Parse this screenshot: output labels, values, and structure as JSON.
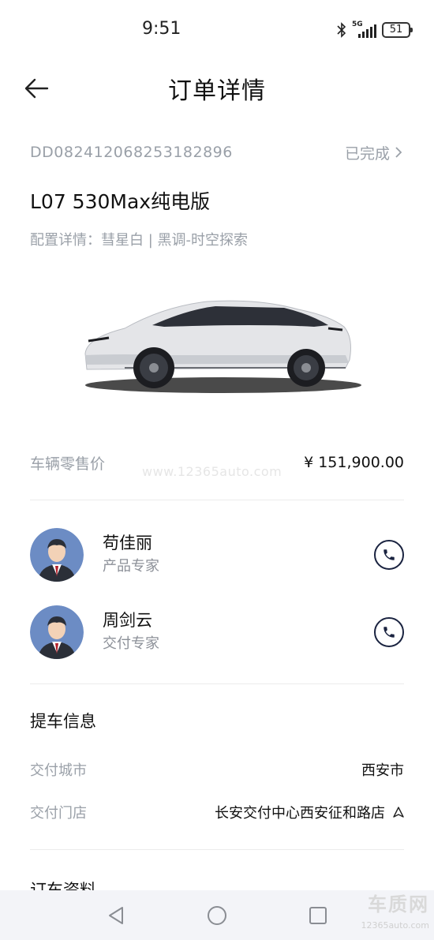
{
  "status_bar": {
    "time": "9:51",
    "network": "5G",
    "battery": "51"
  },
  "header": {
    "title": "订单详情"
  },
  "order": {
    "number": "DD082412068253182896",
    "status": "已完成"
  },
  "vehicle": {
    "name": "L07 530Max纯电版",
    "config": "配置详情：彗星白 | 黑调-时空探索",
    "car_color": "#d9dadd"
  },
  "price": {
    "label": "车辆零售价",
    "value": "¥ 151,900.00",
    "watermark": "www.12365auto.com"
  },
  "contacts": [
    {
      "name": "苟佳丽",
      "role": "产品专家"
    },
    {
      "name": "周剑云",
      "role": "交付专家"
    }
  ],
  "pickup": {
    "title": "提车信息",
    "rows": [
      {
        "label": "交付城市",
        "value": "西安市"
      },
      {
        "label": "交付门店",
        "value": "长安交付中心西安征和路店"
      }
    ]
  },
  "order_info": {
    "title": "订车资料"
  },
  "branding": {
    "logo_text": "车质网",
    "logo_sub": "12365auto.com"
  },
  "colors": {
    "accent": "#1a2340",
    "muted": "#9aa0a8",
    "avatar_bg": "#6c8cc4"
  }
}
